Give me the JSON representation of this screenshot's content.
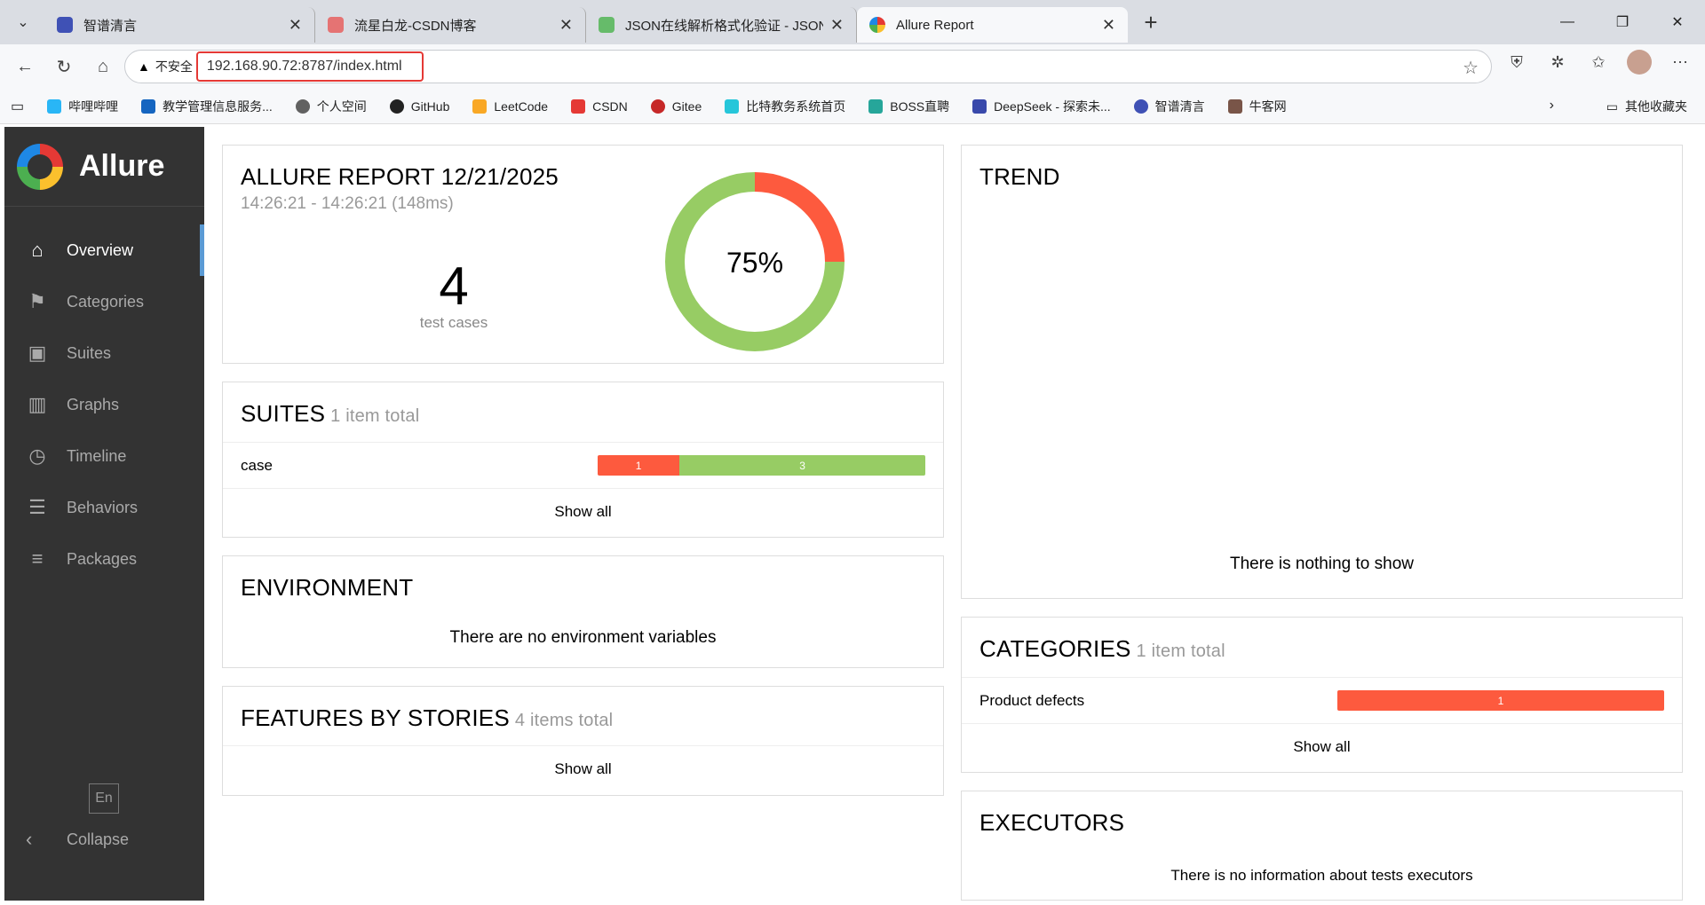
{
  "browser": {
    "tabs": [
      {
        "title": "智谱清言",
        "color": "#3f51b5"
      },
      {
        "title": "流星白龙-CSDN博客",
        "color": "#e57373"
      },
      {
        "title": "JSON在线解析格式化验证 - JSON.c",
        "color": "#66bb6a"
      },
      {
        "title": "Allure Report",
        "color": "#fbc02d"
      }
    ],
    "insecure_label": "不安全",
    "url": "192.168.90.72:8787/index.html",
    "bookmarks": [
      {
        "label": "哔哩哔哩",
        "color": "#29b6f6"
      },
      {
        "label": "教学管理信息服务...",
        "color": "#1565c0"
      },
      {
        "label": "个人空间",
        "color": "#616161"
      },
      {
        "label": "GitHub",
        "color": "#222222"
      },
      {
        "label": "LeetCode",
        "color": "#f9a825"
      },
      {
        "label": "CSDN",
        "color": "#e53935"
      },
      {
        "label": "Gitee",
        "color": "#c62828"
      },
      {
        "label": "比特教务系统首页",
        "color": "#26c6da"
      },
      {
        "label": "BOSS直聘",
        "color": "#26a69a"
      },
      {
        "label": "DeepSeek - 探索未...",
        "color": "#3949ab"
      },
      {
        "label": "智谱清言",
        "color": "#3f51b5"
      },
      {
        "label": "牛客网",
        "color": "#795548"
      }
    ],
    "other_bookmarks": "其他收藏夹"
  },
  "sidebar": {
    "brand": "Allure",
    "items": [
      {
        "label": "Overview",
        "icon": "home-icon",
        "glyph": "⌂"
      },
      {
        "label": "Categories",
        "icon": "flag-icon",
        "glyph": "⚑"
      },
      {
        "label": "Suites",
        "icon": "briefcase-icon",
        "glyph": "▣"
      },
      {
        "label": "Graphs",
        "icon": "bar-chart-icon",
        "glyph": "▥"
      },
      {
        "label": "Timeline",
        "icon": "clock-icon",
        "glyph": "◷"
      },
      {
        "label": "Behaviors",
        "icon": "list-icon",
        "glyph": "☰"
      },
      {
        "label": "Packages",
        "icon": "align-left-icon",
        "glyph": "≡"
      }
    ],
    "lang": "En",
    "collapse": "Collapse"
  },
  "summary": {
    "title": "ALLURE REPORT 12/21/2025",
    "time": "14:26:21 - 14:26:21 (148ms)",
    "count": "4",
    "count_label": "test cases",
    "percent": "75%",
    "pass_fraction": 0.75,
    "colors": {
      "passed": "#97cc64",
      "failed": "#fd5a3e"
    }
  },
  "suites": {
    "title": "SUITES",
    "count": "1 item total",
    "rows": [
      {
        "name": "case",
        "failed": 1,
        "passed": 3
      }
    ],
    "show_all": "Show all"
  },
  "environment": {
    "title": "ENVIRONMENT",
    "message": "There are no environment variables"
  },
  "features": {
    "title": "FEATURES BY STORIES",
    "count": "4 items total",
    "show_all": "Show all"
  },
  "trend": {
    "title": "TREND",
    "message": "There is nothing to show"
  },
  "categories": {
    "title": "CATEGORIES",
    "count": "1 item total",
    "rows": [
      {
        "name": "Product defects",
        "value": 1
      }
    ],
    "show_all": "Show all"
  },
  "executors": {
    "title": "EXECUTORS",
    "message": "There is no information about tests executors"
  }
}
